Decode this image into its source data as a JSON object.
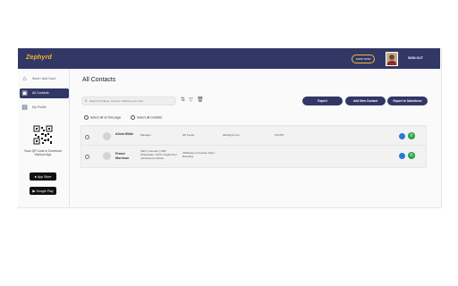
{
  "header": {
    "logo": "Zephyrd",
    "shop_label": "SHOP NOW",
    "signout_label": "SIGN OUT"
  },
  "sidebar": {
    "items": [
      {
        "label": "Send / Add Card",
        "icon": "home-icon"
      },
      {
        "label": "All Contacts",
        "icon": "contacts-icon",
        "active": true
      },
      {
        "label": "My Profile",
        "icon": "profile-icon"
      }
    ],
    "qr_text": "Scan QR Code to Download Zephyrd App",
    "app_store": "App Store",
    "google_play": "Google Play"
  },
  "main": {
    "title": "All Contacts",
    "search_placeholder": "Search by Name, Country, Industry and more",
    "buttons": {
      "export": "Export",
      "add_new_contact": "Add New Contact",
      "export_salesforce": "Export to Salesforce"
    },
    "select_page": "Select all on this page",
    "select_all": "Select all contacts",
    "contacts": [
      {
        "name": "Alicia Wilde",
        "title": "Manager",
        "company": "NP Foods",
        "email": "alicia@nf.com",
        "country": "COUNT"
      },
      {
        "name": "Fraser Morrison",
        "title": "CEO | Founder | OBh Wholesaler | SOS | Digital Stor | Endurance Athlete",
        "company": "1000ways Corporate Team Branding",
        "email": "",
        "country": ""
      }
    ]
  },
  "colors": {
    "primary": "#323766",
    "accent": "#f5b928",
    "whatsapp": "#25a244",
    "message": "#2a78d6"
  }
}
